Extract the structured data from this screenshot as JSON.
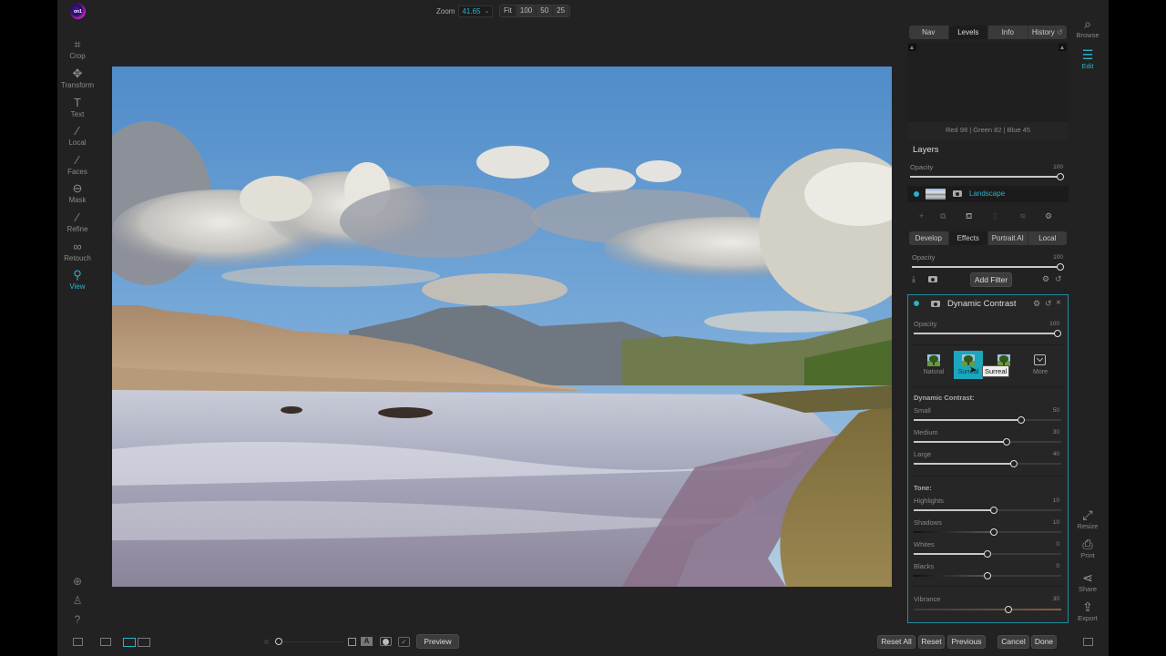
{
  "app": {
    "logo_text": "on1",
    "accent_color": "#2bb3c9"
  },
  "left_tools": [
    {
      "label": "Crop",
      "icon": "crop-icon",
      "glyph": "⌗"
    },
    {
      "label": "Transform",
      "icon": "transform-icon",
      "glyph": "✥"
    },
    {
      "label": "Text",
      "icon": "text-icon",
      "glyph": "T"
    },
    {
      "label": "Local",
      "icon": "local-brush-icon",
      "glyph": "⁄"
    },
    {
      "label": "Faces",
      "icon": "faces-icon",
      "glyph": "⁄"
    },
    {
      "label": "Mask",
      "icon": "mask-icon",
      "glyph": "⊖"
    },
    {
      "label": "Refine",
      "icon": "refine-icon",
      "glyph": "⁄"
    },
    {
      "label": "Retouch",
      "icon": "retouch-icon",
      "glyph": "∞"
    },
    {
      "label": "View",
      "icon": "view-icon",
      "glyph": "⚲",
      "active": true
    }
  ],
  "left_utils": [
    {
      "icon": "sync-icon",
      "glyph": "⊕"
    },
    {
      "icon": "account-icon",
      "glyph": "♙"
    },
    {
      "icon": "help-icon",
      "glyph": "?"
    }
  ],
  "zoom": {
    "label": "Zoom",
    "value": "41.65",
    "presets": [
      "Fit",
      "100",
      "50",
      "25"
    ]
  },
  "nav_tabs": [
    {
      "label": "Nav"
    },
    {
      "label": "Levels",
      "active": true
    },
    {
      "label": "Info"
    },
    {
      "label": "History"
    }
  ],
  "histogram": {
    "readout": "Red  98  | Green  82  | Blue  45"
  },
  "layers": {
    "title": "Layers",
    "opacity_label": "Opacity",
    "opacity_value": "100",
    "opacity_fraction": 1.0,
    "layer_name": "Landscape"
  },
  "module_tabs": [
    {
      "label": "Develop"
    },
    {
      "label": "Effects",
      "active": true
    },
    {
      "label": "Portrait AI"
    },
    {
      "label": "Local"
    }
  ],
  "effects": {
    "opacity_label": "Opacity",
    "opacity_value": "100",
    "opacity_fraction": 1.0,
    "add_filter_label": "Add Filter"
  },
  "filter": {
    "title": "Dynamic Contrast",
    "opacity_label": "Opacity",
    "opacity_value": "100",
    "opacity_fraction": 1.0,
    "presets": [
      {
        "label": "Natural"
      },
      {
        "label": "Surreal",
        "active": true
      },
      {
        "label": ""
      },
      {
        "label": "More"
      }
    ],
    "tooltip": "Surreal",
    "section_contrast": "Dynamic Contrast:",
    "contrast_sliders": [
      {
        "label": "Small",
        "value": "50",
        "fraction": 0.73
      },
      {
        "label": "Medium",
        "value": "30",
        "fraction": 0.63
      },
      {
        "label": "Large",
        "value": "40",
        "fraction": 0.68
      }
    ],
    "section_tone": "Tone:",
    "tone_sliders": [
      {
        "label": "Highlights",
        "value": "10",
        "fraction": 0.545
      },
      {
        "label": "Shadows",
        "value": "10",
        "fraction": 0.545
      },
      {
        "label": "Whites",
        "value": "0",
        "fraction": 0.5
      },
      {
        "label": "Blacks",
        "value": "0",
        "fraction": 0.5
      }
    ],
    "vibrance": {
      "label": "Vibrance",
      "value": "30",
      "fraction": 0.64
    }
  },
  "right_nav_top": [
    {
      "label": "Browse",
      "icon": "browse-icon",
      "glyph": "⌕"
    },
    {
      "label": "Edit",
      "icon": "edit-sliders-icon",
      "glyph": "☰",
      "active": true
    }
  ],
  "right_nav_bottom": [
    {
      "label": "Resize",
      "icon": "resize-icon",
      "glyph": "⤢"
    },
    {
      "label": "Print",
      "icon": "print-icon",
      "glyph": "⎙"
    },
    {
      "label": "Share",
      "icon": "share-icon",
      "glyph": "⋖"
    },
    {
      "label": "Export",
      "icon": "export-icon",
      "glyph": "⇪"
    }
  ],
  "bottom": {
    "preview_label": "Preview",
    "buttons": [
      "Reset All",
      "Reset",
      "Previous",
      "Cancel",
      "Done"
    ]
  }
}
